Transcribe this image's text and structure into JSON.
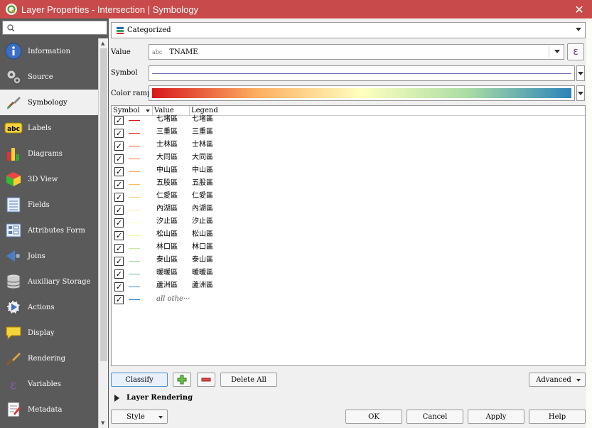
{
  "window": {
    "title": "Layer Properties - Intersection | Symbology",
    "close_symbol": "✕"
  },
  "sidebar": {
    "search_placeholder": "",
    "items": [
      {
        "label": "Information",
        "icon": "info-icon"
      },
      {
        "label": "Source",
        "icon": "source-icon"
      },
      {
        "label": "Symbology",
        "icon": "paintbrush-icon",
        "active": true
      },
      {
        "label": "Labels",
        "icon": "abc-label-icon"
      },
      {
        "label": "Diagrams",
        "icon": "diagram-icon"
      },
      {
        "label": "3D View",
        "icon": "cube-icon"
      },
      {
        "label": "Fields",
        "icon": "fields-icon"
      },
      {
        "label": "Attributes Form",
        "icon": "form-icon"
      },
      {
        "label": "Joins",
        "icon": "join-icon"
      },
      {
        "label": "Auxiliary Storage",
        "icon": "database-icon"
      },
      {
        "label": "Actions",
        "icon": "actions-icon"
      },
      {
        "label": "Display",
        "icon": "speech-bubble-icon"
      },
      {
        "label": "Rendering",
        "icon": "brush-icon"
      },
      {
        "label": "Variables",
        "icon": "epsilon-icon"
      },
      {
        "label": "Metadata",
        "icon": "metadata-icon"
      }
    ]
  },
  "renderer": {
    "type": "Categorized"
  },
  "value_field": {
    "label": "Value",
    "type_hint": "abc",
    "value": "TNAME",
    "expression_symbol": "ε"
  },
  "symbol": {
    "label": "Symbol"
  },
  "color_ramp": {
    "label": "Color ramp",
    "colors": [
      "#d7191c",
      "#fdae61",
      "#ffffbf",
      "#abdda4",
      "#2b83ba"
    ]
  },
  "categories": {
    "headers": {
      "symbol": "Symbol",
      "value": "Value",
      "legend": "Legend"
    },
    "rows": [
      {
        "value": "七堵區",
        "legend": "七堵區",
        "color": "#d7191c"
      },
      {
        "value": "三重區",
        "legend": "三重區",
        "color": "#de3a26"
      },
      {
        "value": "士林區",
        "legend": "士林區",
        "color": "#e55c31"
      },
      {
        "value": "大同區",
        "legend": "大同區",
        "color": "#ec7d3b"
      },
      {
        "value": "中山區",
        "legend": "中山區",
        "color": "#f59f4a"
      },
      {
        "value": "五股區",
        "legend": "五股區",
        "color": "#fbbb62"
      },
      {
        "value": "仁愛區",
        "legend": "仁愛區",
        "color": "#fdd384"
      },
      {
        "value": "內湖區",
        "legend": "內湖區",
        "color": "#feeaa5"
      },
      {
        "value": "汐止區",
        "legend": "汐止區",
        "color": "#fefcbd"
      },
      {
        "value": "松山區",
        "legend": "松山區",
        "color": "#e9f6b0"
      },
      {
        "value": "林口區",
        "legend": "林口區",
        "color": "#ccea9f"
      },
      {
        "value": "泰山區",
        "legend": "泰山區",
        "color": "#a3d7a6"
      },
      {
        "value": "暖暖區",
        "legend": "暖暖區",
        "color": "#6fb6b1"
      },
      {
        "value": "蘆洲區",
        "legend": "蘆洲區",
        "color": "#3f94bd"
      }
    ],
    "all_other": {
      "value": "all othe···",
      "color": "#2b83ba"
    },
    "checked_mark": "✓"
  },
  "buttons": {
    "classify": "Classify",
    "delete_all": "Delete All",
    "advanced": "Advanced",
    "style": "Style",
    "ok": "OK",
    "cancel": "Cancel",
    "apply": "Apply",
    "help": "Help"
  },
  "layer_rendering": {
    "label": "Layer Rendering"
  }
}
